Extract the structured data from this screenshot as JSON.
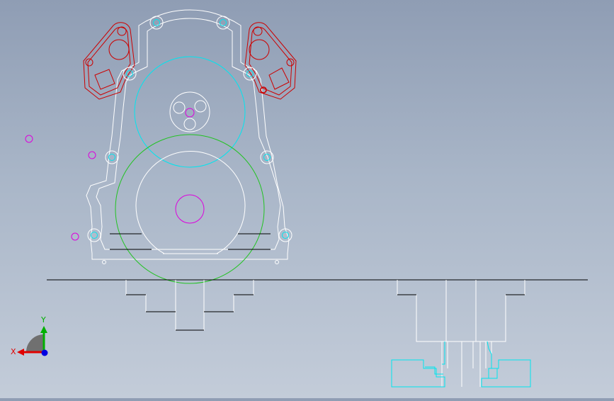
{
  "viewport": {
    "name": "cad-graphics-area",
    "colors": {
      "background_top": "#8f9db4",
      "background_bottom": "#c3ccd9",
      "edge": "#ffffff",
      "sketch_line": "#000000",
      "timing_gear_circle": "#00e5ee",
      "crank_gear_circle": "#22c322",
      "construction_circle": "#dd00dd",
      "valve_cover_flange": "#cc0000",
      "bolt_boss": "#00e5ee",
      "section_detail": "#00e5ee"
    }
  },
  "triad": {
    "x_label": "X",
    "y_label": "Y",
    "colors": {
      "x_axis": "#e00000",
      "y_axis": "#00b000",
      "z_axis": "#0000e0",
      "origin_disc": "#707070"
    }
  }
}
